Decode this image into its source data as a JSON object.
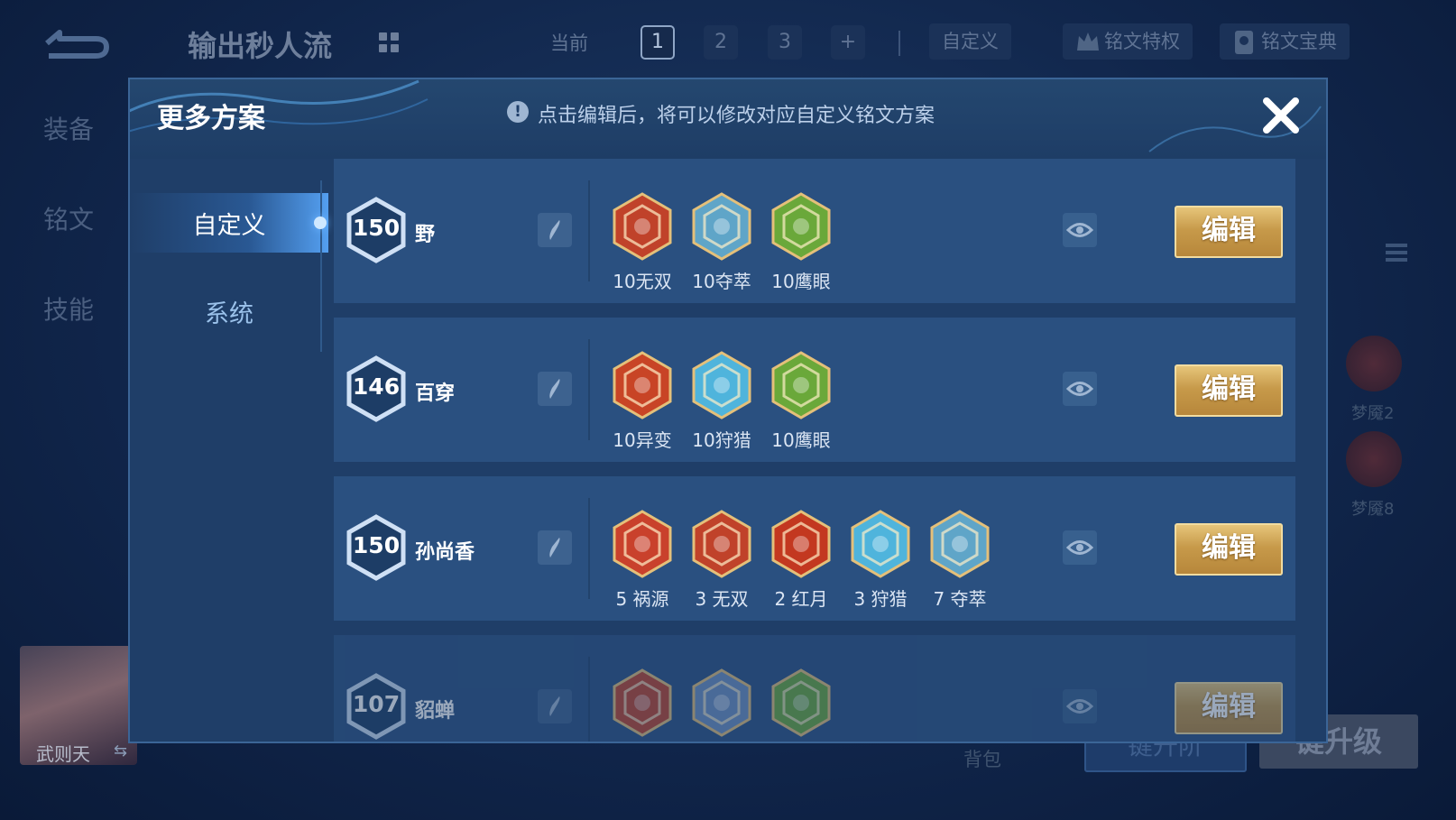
{
  "background": {
    "scheme_name": "输出秒人流",
    "current_label": "当前",
    "pages": [
      "1",
      "2",
      "3",
      "+"
    ],
    "custom_label": "自定义",
    "privilege_label": "铭文特权",
    "codex_label": "铭文宝典",
    "tabs": [
      "装备",
      "铭文",
      "技能"
    ],
    "side_runes": [
      "梦魇2",
      "梦魇8"
    ],
    "hero_name": "武则天",
    "bag_label": "背包",
    "button_one": "键升阶",
    "button_two": "键升级"
  },
  "dialog": {
    "title": "更多方案",
    "hint": "点击编辑后，将可以修改对应自定义铭文方案",
    "menu": [
      "自定义",
      "系统"
    ],
    "edit_label": "编辑",
    "rows": [
      {
        "level": "150",
        "name": "野",
        "runes": [
          {
            "label": "10无双",
            "color": "#c0422a",
            "icon": "wushuang-rune-icon"
          },
          {
            "label": "10夺萃",
            "color": "#5fa5c8",
            "icon": "duocui-rune-icon"
          },
          {
            "label": "10鹰眼",
            "color": "#6aa83a",
            "icon": "yingyan-rune-icon"
          }
        ]
      },
      {
        "level": "146",
        "name": "百穿",
        "runes": [
          {
            "label": "10异变",
            "color": "#c84426",
            "icon": "yibian-rune-icon"
          },
          {
            "label": "10狩猎",
            "color": "#4fb4dc",
            "icon": "shoulie-rune-icon"
          },
          {
            "label": "10鹰眼",
            "color": "#6aa83a",
            "icon": "yingyan-rune-icon"
          }
        ]
      },
      {
        "level": "150",
        "name": "孙尚香",
        "runes": [
          {
            "label": "5 祸源",
            "color": "#c9412c",
            "icon": "huoyuan-rune-icon"
          },
          {
            "label": "3 无双",
            "color": "#c0422a",
            "icon": "wushuang-rune-icon"
          },
          {
            "label": "2 红月",
            "color": "#c33820",
            "icon": "hongyue-rune-icon"
          },
          {
            "label": "3 狩猎",
            "color": "#4fb4dc",
            "icon": "shoulie-rune-icon"
          },
          {
            "label": "7 夺萃",
            "color": "#5fa5c8",
            "icon": "duocui-rune-icon"
          }
        ]
      },
      {
        "level": "107",
        "name": "貂蝉",
        "runes": [
          {
            "label": "",
            "color": "#c0422a",
            "icon": "red-rune-icon"
          },
          {
            "label": "",
            "color": "#6d8fc0",
            "icon": "blue-rune-icon"
          },
          {
            "label": "",
            "color": "#6aa83a",
            "icon": "green-rune-icon"
          }
        ]
      }
    ]
  }
}
